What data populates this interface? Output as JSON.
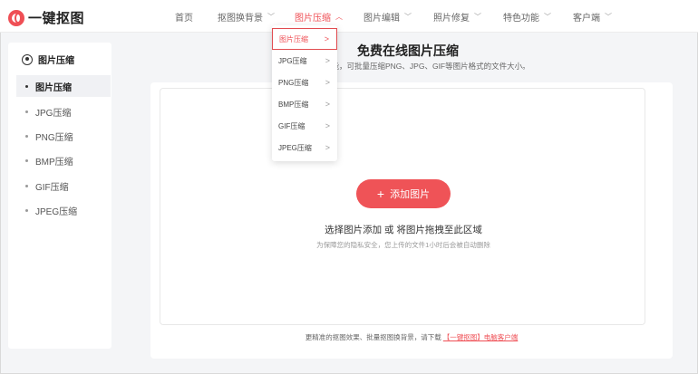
{
  "brand": {
    "name": "一键抠图",
    "accent": "#ef4f55"
  },
  "nav": {
    "items": [
      {
        "label": "首页",
        "has_dropdown": false
      },
      {
        "label": "抠图换背景",
        "has_dropdown": true
      },
      {
        "label": "图片压缩",
        "has_dropdown": true,
        "active": true
      },
      {
        "label": "图片编辑",
        "has_dropdown": true
      },
      {
        "label": "照片修复",
        "has_dropdown": true
      },
      {
        "label": "特色功能",
        "has_dropdown": true
      },
      {
        "label": "客户端",
        "has_dropdown": true
      }
    ]
  },
  "dropdown": {
    "items": [
      {
        "label": "图片压缩",
        "active": true
      },
      {
        "label": "JPG压缩"
      },
      {
        "label": "PNG压缩"
      },
      {
        "label": "BMP压缩"
      },
      {
        "label": "GIF压缩"
      },
      {
        "label": "JPEG压缩"
      }
    ],
    "arrow_glyph": ">"
  },
  "sidebar": {
    "heading": "图片压缩",
    "items": [
      {
        "label": "图片压缩",
        "active": true
      },
      {
        "label": "JPG压缩"
      },
      {
        "label": "PNG压缩"
      },
      {
        "label": "BMP压缩"
      },
      {
        "label": "GIF压缩"
      },
      {
        "label": "JPEG压缩"
      }
    ]
  },
  "main": {
    "title": "免费在线图片压缩",
    "description": "功能，可批量压缩PNG、JPG、GIF等图片格式的文件大小。",
    "upload": {
      "button_label": "添加图片",
      "hint": "选择图片添加 或 将图片拖拽至此区域",
      "privacy": "为保障您的隐私安全，您上传的文件1小时后会被自动删除"
    },
    "footer": {
      "text": "更精准的抠图效果、批量抠图换背景，请下载",
      "link": "【一键抠图】电脑客户端"
    }
  }
}
